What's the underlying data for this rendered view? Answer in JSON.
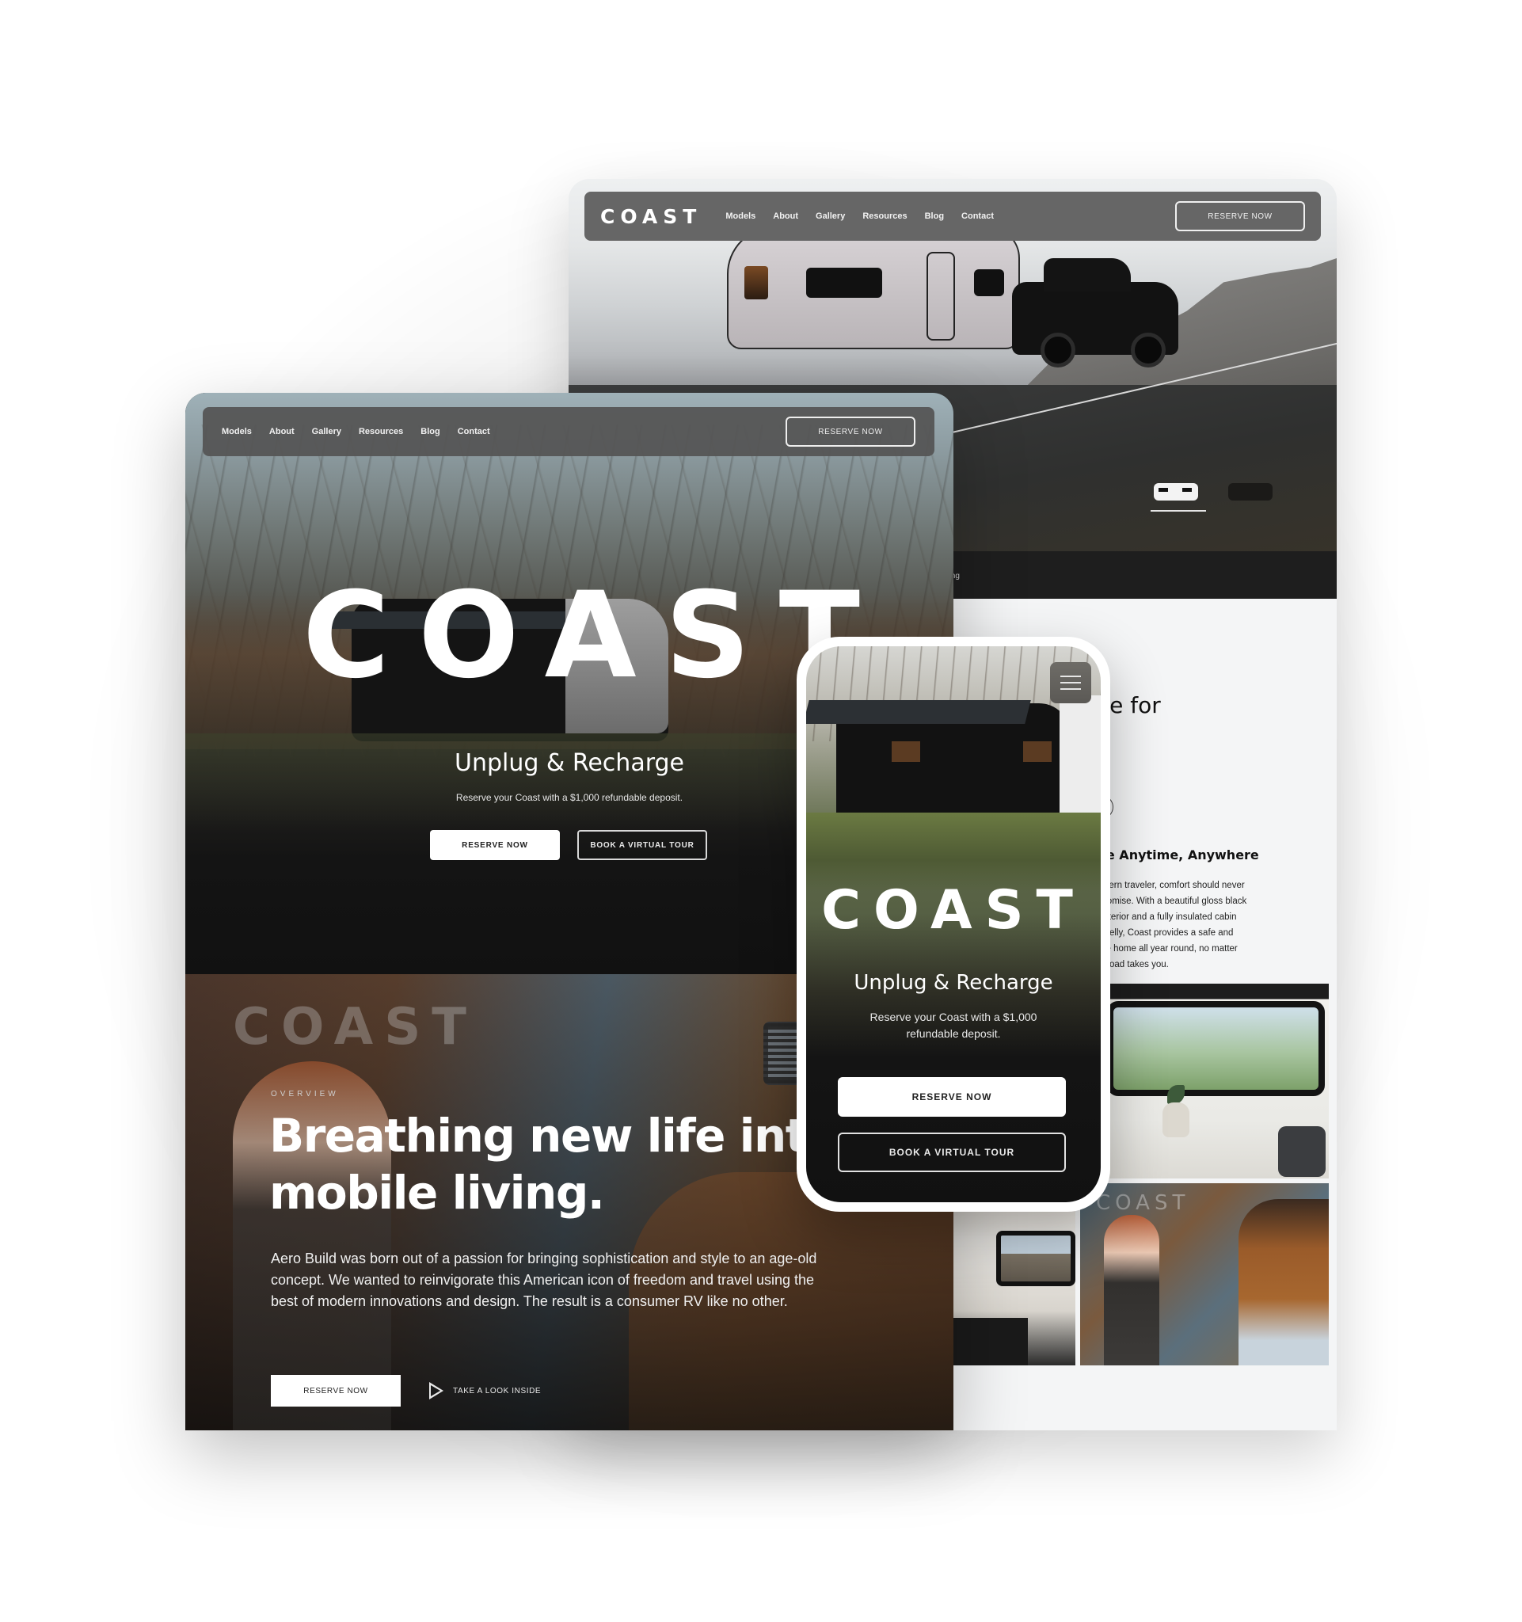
{
  "brand": {
    "logo": "COAST",
    "accent_colors": {
      "nav_background": "#666666",
      "hero_dark": "#121212",
      "button_white": "#ffffff",
      "text_light": "#f2f2f2"
    }
  },
  "back_desktop": {
    "nav": {
      "logo": "COAST",
      "items": [
        "Models",
        "About",
        "Gallery",
        "Resources",
        "Blog",
        "Contact"
      ],
      "cta": "RESERVE NOW"
    },
    "model_picker": [
      {
        "name": "white-model",
        "selected": true
      },
      {
        "name": "black-model",
        "selected": false
      }
    ],
    "footer_link_fragment": "ncing",
    "feature": {
      "heading_fragment": "cle for",
      "subheading_fragment": "ore Anytime, Anywhere",
      "paragraph_lines": [
        "modern traveler, comfort should never",
        "mpromise. With a beautiful gloss black",
        "e exterior and a fully insulated cabin",
        "derbelly, Coast provides a safe and",
        "table home all year round, no matter",
        "the road takes you."
      ]
    },
    "gallery_stamp": "COAST"
  },
  "front_desktop": {
    "nav": {
      "items": [
        "Models",
        "About",
        "Gallery",
        "Resources",
        "Blog",
        "Contact"
      ],
      "cta": "RESERVE NOW"
    },
    "hero": {
      "wordmark": "COAST",
      "title": "Unplug & Recharge",
      "subtitle": "Reserve your Coast with a $1,000 refundable deposit.",
      "primary_cta": "RESERVE NOW",
      "secondary_cta": "BOOK A VIRTUAL TOUR"
    },
    "overview": {
      "stamp": "COAST",
      "eyebrow": "OVERVIEW",
      "title": "Breathing new life into mobile living.",
      "body": "Aero Build was born out of a passion for bringing sophistication and style to an age-old concept. We wanted to reinvigorate this American icon of freedom and travel using the best of modern innovations and design. The result is a consumer RV like no other.",
      "primary_cta": "RESERVE NOW",
      "secondary_cta": "TAKE A LOOK INSIDE",
      "secondary_icon": "play-icon"
    }
  },
  "mobile": {
    "menu_icon": "hamburger-icon",
    "wordmark": "COAST",
    "title": "Unplug & Recharge",
    "subtitle": "Reserve your Coast with a $1,000 refundable deposit.",
    "primary_cta": "RESERVE NOW",
    "secondary_cta": "BOOK A VIRTUAL TOUR"
  }
}
